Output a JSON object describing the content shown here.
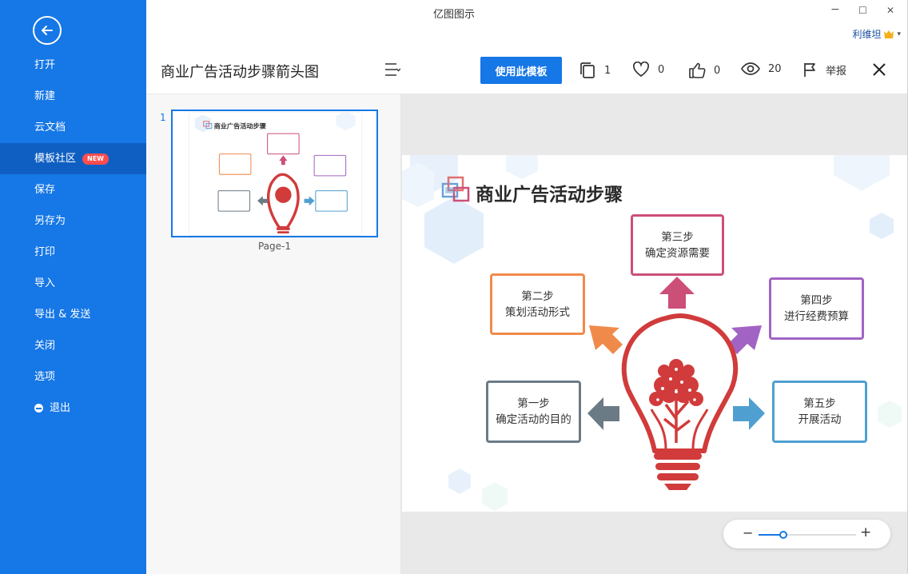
{
  "app": {
    "title": "亿图图示"
  },
  "window": {
    "minimize": "−",
    "maximize": "☐",
    "close": "✕"
  },
  "user": {
    "name": "利维坦",
    "dropdown": "▾"
  },
  "sidebar": {
    "items": [
      {
        "label": "打开"
      },
      {
        "label": "新建"
      },
      {
        "label": "云文档"
      },
      {
        "label": "模板社区",
        "badge": "NEW"
      },
      {
        "label": "保存"
      },
      {
        "label": "另存为"
      },
      {
        "label": "打印"
      },
      {
        "label": "导入"
      },
      {
        "label": "导出 & 发送"
      },
      {
        "label": "关闭"
      },
      {
        "label": "选项"
      },
      {
        "label": "退出"
      }
    ]
  },
  "toolbar": {
    "template_title": "商业广告活动步骤箭头图",
    "use_button": "使用此模板",
    "copies": "1",
    "likes": "0",
    "thumbs": "0",
    "views": "20",
    "report": "举报"
  },
  "pages": {
    "number": "1",
    "label": "Page-1"
  },
  "diagram": {
    "title": "商业广告活动步骤",
    "steps": [
      {
        "line1": "第一步",
        "line2": "确定活动的目的",
        "color": "#6b7b86"
      },
      {
        "line1": "第二步",
        "line2": "策划活动形式",
        "color": "#f08a4b"
      },
      {
        "line1": "第三步",
        "line2": "确定资源需要",
        "color": "#cc4f78"
      },
      {
        "line1": "第四步",
        "line2": "进行经费预算",
        "color": "#a264c4"
      },
      {
        "line1": "第五步",
        "line2": "开展活动",
        "color": "#4fa0d0"
      }
    ],
    "bulb_color": "#d13b3b"
  },
  "zoom": {
    "minus": "−",
    "plus": "+",
    "level": 0.25
  },
  "colors": {
    "accent": "#1677e6",
    "sidebar_active": "#0f5fc2",
    "badge": "#ff4d4f"
  }
}
